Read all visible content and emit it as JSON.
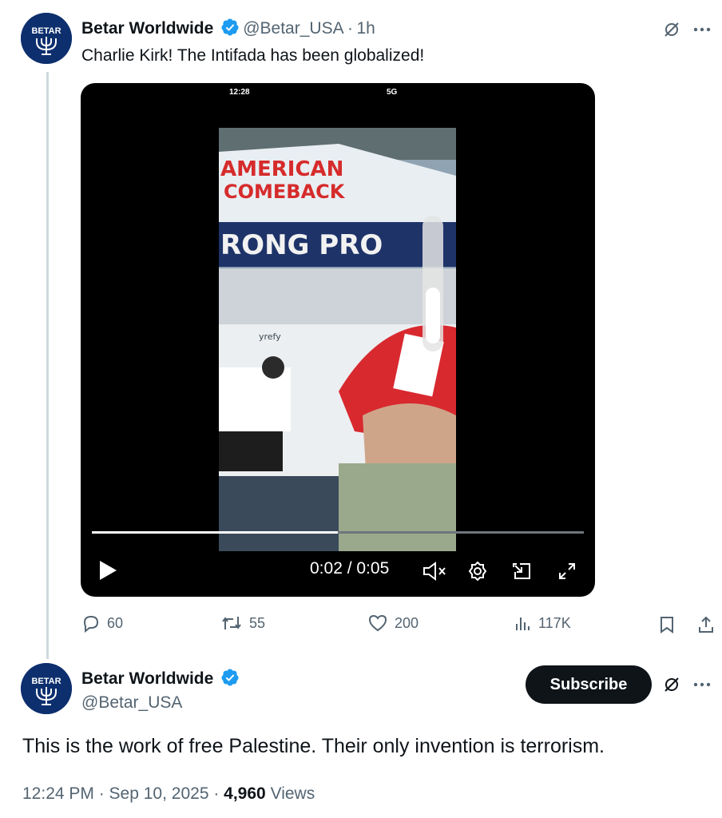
{
  "tweet1": {
    "author_name": "Betar Worldwide",
    "handle": "@Betar_USA",
    "separator": "·",
    "time_ago": "1h",
    "text": "Charlie Kirk! The Intifada has been globalized!",
    "avatar_text": "BETAR",
    "video": {
      "phone_time": "12:28",
      "phone_status_right": "5G",
      "current_time": "0:02",
      "duration": "0:05",
      "time_display": "0:02 / 0:05",
      "progress_fraction": 0.5,
      "sign_line1": "AMERICAN",
      "sign_line2": "COMEBACK",
      "sign_line3": "RONG PRO",
      "yrefy_label": "yrefy"
    },
    "stats": {
      "replies": "60",
      "reposts": "55",
      "likes": "200",
      "views": "117K"
    }
  },
  "tweet2": {
    "author_name": "Betar Worldwide",
    "handle": "@Betar_USA",
    "avatar_text": "BETAR",
    "subscribe_label": "Subscribe",
    "text": "This is the work of free Palestine. Their only invention is terrorism.",
    "timestamp": "12:24 PM · Sep 10, 2025",
    "meta_sep": " · ",
    "views_count": "4,960",
    "views_label": " Views"
  },
  "colors": {
    "verified_blue": "#1d9bf0",
    "text_primary": "#0f1419",
    "text_secondary": "#536471",
    "avatar_navy": "#0d2f6e"
  },
  "icons": [
    "verified-icon",
    "grok-icon",
    "more-icon",
    "play-icon",
    "mute-icon",
    "settings-icon",
    "pip-icon",
    "fullscreen-icon",
    "reply-icon",
    "repost-icon",
    "like-icon",
    "views-icon",
    "bookmark-icon",
    "share-icon"
  ]
}
